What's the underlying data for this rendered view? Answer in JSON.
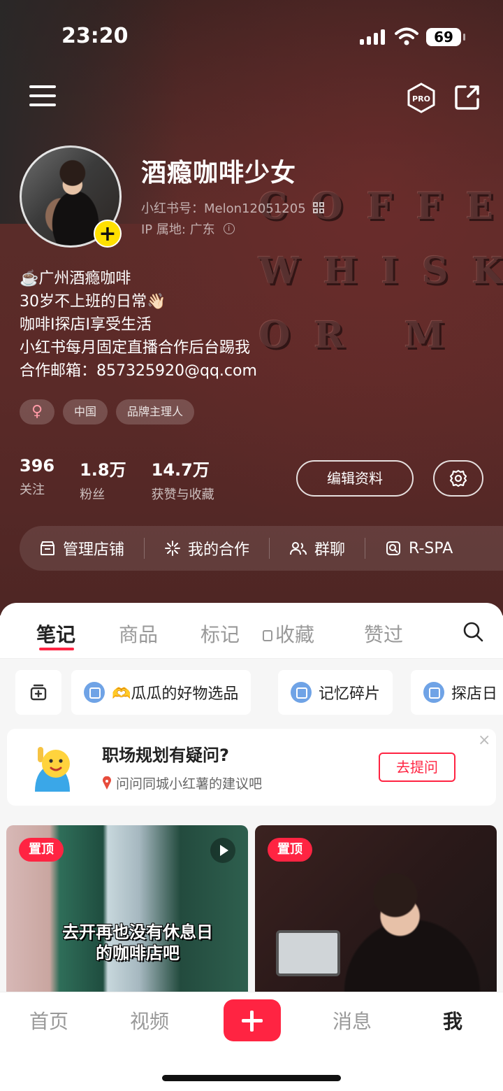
{
  "status_bar": {
    "time": "23:20",
    "battery": "69"
  },
  "profile": {
    "nickname": "酒瘾咖啡少女",
    "red_id": "小红书号：Melon12051205",
    "ip_location": "IP 属地: 广东",
    "bio_lines": [
      "☕️广州酒瘾咖啡",
      "30岁不上班的日常👋🏻",
      "咖啡I探店I享受生活",
      "小红书每月固定直播合作后台踢我",
      "合作邮箱：857325920@qq.com"
    ],
    "tags": [
      "♀",
      "中国",
      "品牌主理人"
    ],
    "stats": [
      {
        "value": "396",
        "label": "关注"
      },
      {
        "value": "1.8万",
        "label": "粉丝"
      },
      {
        "value": "14.7万",
        "label": "获赞与收藏"
      }
    ],
    "edit_label": "编辑资料"
  },
  "background_text": [
    "COFFEE",
    "WHISKY",
    "OR M"
  ],
  "services": [
    {
      "label": "管理店铺",
      "icon": "store-icon"
    },
    {
      "label": "我的合作",
      "icon": "sparkle-icon"
    },
    {
      "label": "群聊",
      "icon": "group-icon"
    },
    {
      "label": "R-SPA",
      "icon": "r-spa-icon"
    }
  ],
  "tabs": [
    "笔记",
    "商品",
    "标记",
    "收藏",
    "赞过"
  ],
  "active_tab": "笔记",
  "collections": [
    "🫶瓜瓜的好物选品",
    "记忆碎片",
    "探店日"
  ],
  "prompt": {
    "title": "职场规划有疑问?",
    "subtitle": "问问同城小红薯的建议吧",
    "button": "去提问",
    "close": "×"
  },
  "notes": [
    {
      "badge": "置顶",
      "caption": "去开再也没有休息日的咖啡店吧",
      "is_video": true
    },
    {
      "badge": "置顶",
      "caption": "",
      "is_video": false
    }
  ],
  "bottom_nav": {
    "items": [
      "首页",
      "视频",
      "消息",
      "我"
    ],
    "active": "我"
  },
  "colors": {
    "accent": "#ff2442",
    "hero_bg": "#5a2c29",
    "add_badge": "#ffe000"
  }
}
